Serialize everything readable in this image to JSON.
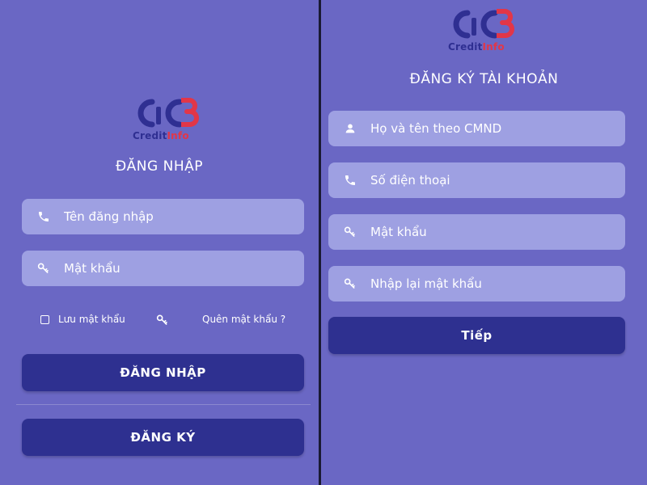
{
  "brand": {
    "logo_credit": "Credit",
    "logo_info": "Info",
    "primary_color": "#2e3090",
    "accent_color": "#e23648",
    "background_color": "#6a67c4",
    "field_color": "#9ea0e2"
  },
  "login": {
    "title": "ĐĂNG NHẬP",
    "username_placeholder": "Tên đăng nhập",
    "username_icon": "phone-icon",
    "password_placeholder": "Mật khẩu",
    "password_icon": "key-icon",
    "remember_label": "Lưu mật khẩu",
    "forgot_label": "Quên mật khẩu ?",
    "login_button": "ĐĂNG NHẬP",
    "register_button": "ĐĂNG KÝ"
  },
  "register": {
    "title": "ĐĂNG KÝ TÀI KHOẢN",
    "fullname_placeholder": "Họ và tên theo CMND",
    "fullname_icon": "user-icon",
    "phone_placeholder": "Số điện thoại",
    "phone_icon": "phone-icon",
    "password_placeholder": "Mật khẩu",
    "password_icon": "key-icon",
    "confirm_placeholder": "Nhập lại mật khẩu",
    "confirm_icon": "key-icon",
    "next_button": "Tiếp"
  }
}
